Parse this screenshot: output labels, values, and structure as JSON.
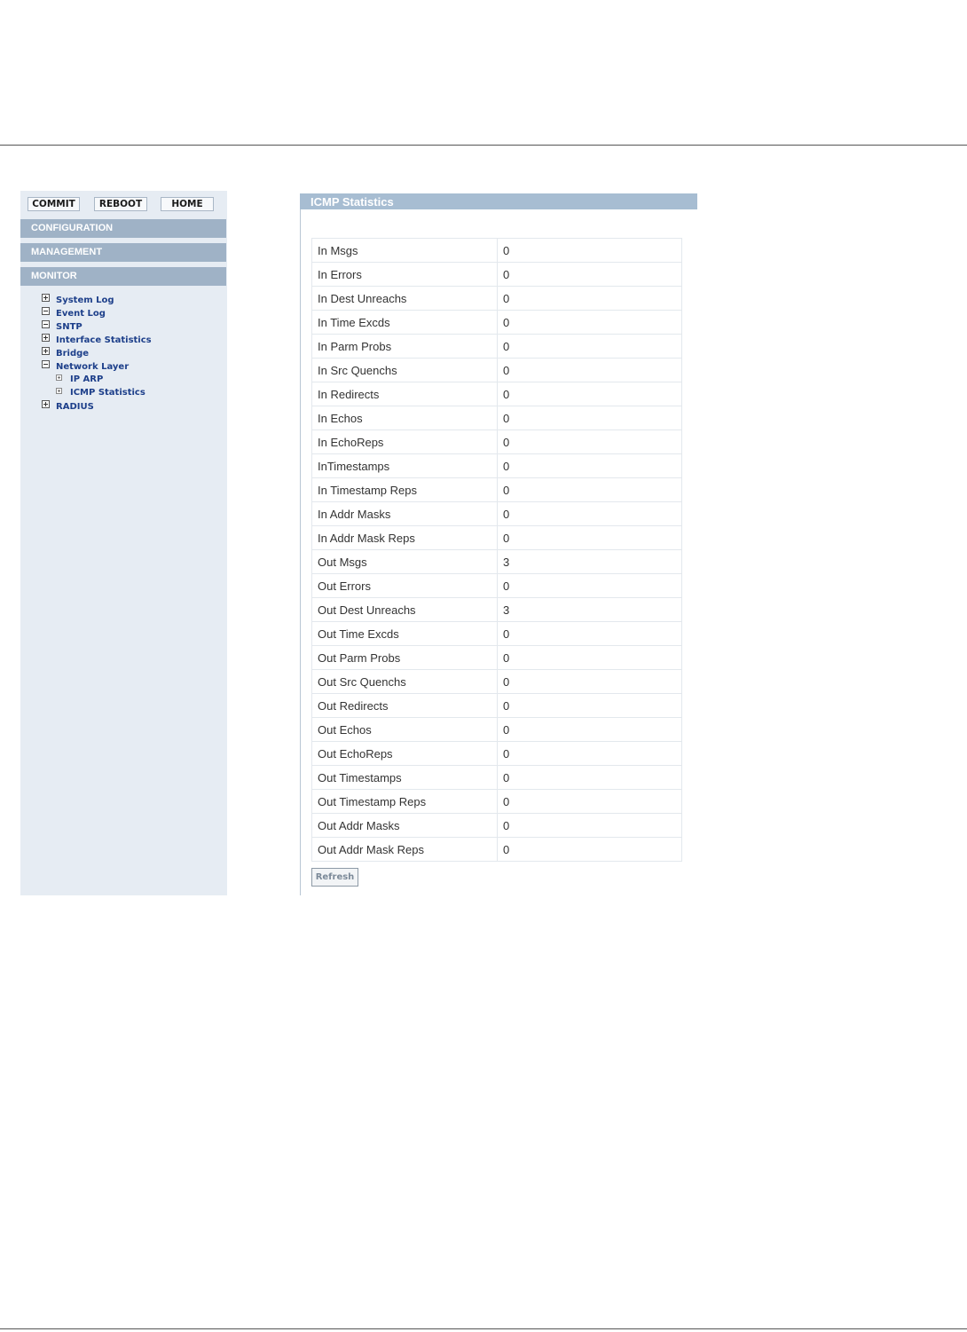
{
  "toolbar": {
    "commit_label": "COMMIT",
    "reboot_label": "REBOOT",
    "home_label": "HOME"
  },
  "sections": {
    "configuration": "CONFIGURATION",
    "management": "MANAGEMENT",
    "monitor": "MONITOR"
  },
  "tree": {
    "items": [
      {
        "label": "System Log",
        "state": "collapsed"
      },
      {
        "label": "Event Log",
        "state": "expanded"
      },
      {
        "label": "SNTP",
        "state": "expanded"
      },
      {
        "label": "Interface Statistics",
        "state": "collapsed"
      },
      {
        "label": "Bridge",
        "state": "collapsed"
      },
      {
        "label": "Network Layer",
        "state": "expanded"
      },
      {
        "label": "IP ARP",
        "state": "leaf"
      },
      {
        "label": "ICMP Statistics",
        "state": "leaf"
      },
      {
        "label": "RADIUS",
        "state": "collapsed"
      }
    ]
  },
  "main": {
    "title": "ICMP Statistics",
    "rows": [
      {
        "label": "In Msgs",
        "value": "0"
      },
      {
        "label": "In Errors",
        "value": "0"
      },
      {
        "label": "In Dest Unreachs",
        "value": "0"
      },
      {
        "label": "In Time Excds",
        "value": "0"
      },
      {
        "label": "In Parm Probs",
        "value": "0"
      },
      {
        "label": "In Src Quenchs",
        "value": "0"
      },
      {
        "label": "In Redirects",
        "value": "0"
      },
      {
        "label": "In Echos",
        "value": "0"
      },
      {
        "label": "In EchoReps",
        "value": "0"
      },
      {
        "label": "InTimestamps",
        "value": "0"
      },
      {
        "label": "In Timestamp Reps",
        "value": "0"
      },
      {
        "label": "In Addr Masks",
        "value": "0"
      },
      {
        "label": "In Addr Mask Reps",
        "value": "0"
      },
      {
        "label": "Out Msgs",
        "value": "3"
      },
      {
        "label": "Out Errors",
        "value": "0"
      },
      {
        "label": "Out Dest Unreachs",
        "value": "3"
      },
      {
        "label": "Out Time Excds",
        "value": "0"
      },
      {
        "label": "Out Parm Probs",
        "value": "0"
      },
      {
        "label": "Out Src Quenchs",
        "value": "0"
      },
      {
        "label": "Out Redirects",
        "value": "0"
      },
      {
        "label": "Out Echos",
        "value": "0"
      },
      {
        "label": "Out EchoReps",
        "value": "0"
      },
      {
        "label": "Out Timestamps",
        "value": "0"
      },
      {
        "label": "Out Timestamp Reps",
        "value": "0"
      },
      {
        "label": "Out Addr Masks",
        "value": "0"
      },
      {
        "label": "Out Addr Mask Reps",
        "value": "0"
      }
    ],
    "refresh_label": "Refresh"
  },
  "colors": {
    "section_bar": "#9fb2c6",
    "title_bar": "#a7bdd2",
    "sidebar_bg": "#e6ecf3",
    "link": "#1d3f8a"
  },
  "icons": {
    "collapsed": "plus-box-icon",
    "expanded": "minus-box-icon",
    "leaf": "small-box-icon"
  }
}
